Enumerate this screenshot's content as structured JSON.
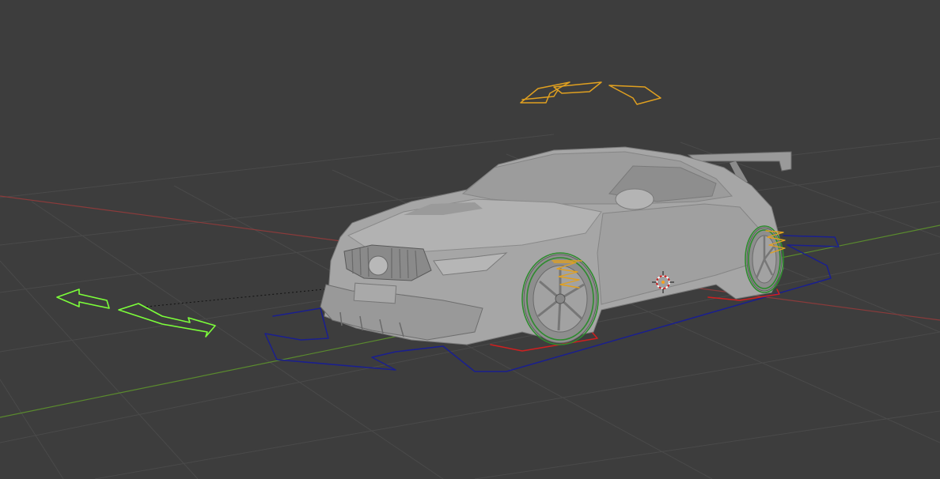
{
  "viewport": {
    "background": "#3d3d3d",
    "grid_color": "#4a4a4a",
    "x_axis_color": "#8a3b3b",
    "y_axis_color": "#5a8a2e"
  },
  "rig": {
    "root_control_color": "#1a1f8f",
    "wheel_control_color": "#2e8b2e",
    "suspension_control_color": "#e0a020",
    "steering_control_color": "#e0a020",
    "direction_arrow_color": "#7cff3a",
    "ground_contact_color": "#d02020",
    "body_color": "#a6a6a6"
  },
  "icons": {
    "cursor": "3d-cursor-icon"
  }
}
